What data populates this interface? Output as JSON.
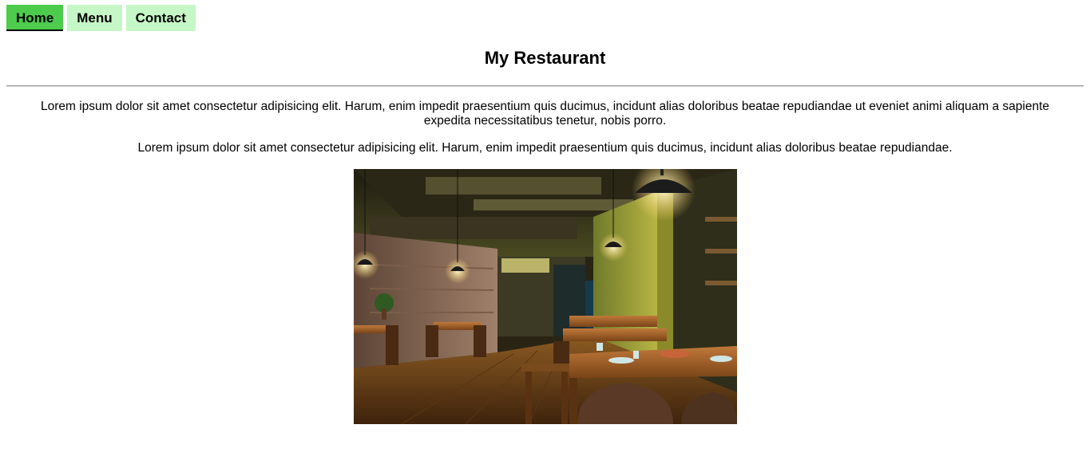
{
  "nav": {
    "items": [
      {
        "label": "Home",
        "active": true
      },
      {
        "label": "Menu",
        "active": false
      },
      {
        "label": "Contact",
        "active": false
      }
    ],
    "active_color": "#4ccb4c",
    "inactive_color": "#c6f7c6"
  },
  "header": {
    "title": "My Restaurant"
  },
  "content": {
    "paragraph_1": "Lorem ipsum dolor sit amet consectetur adipisicing elit. Harum, enim impedit praesentium quis ducimus, incidunt alias doloribus beatae repudiandae ut eveniet animi aliquam a sapiente expedita necessitatibus tenetur, nobis porro.",
    "paragraph_2": "Lorem ipsum dolor sit amet consectetur adipisicing elit. Harum, enim impedit praesentium quis ducimus, incidunt alias doloribus beatae repudiandae."
  }
}
